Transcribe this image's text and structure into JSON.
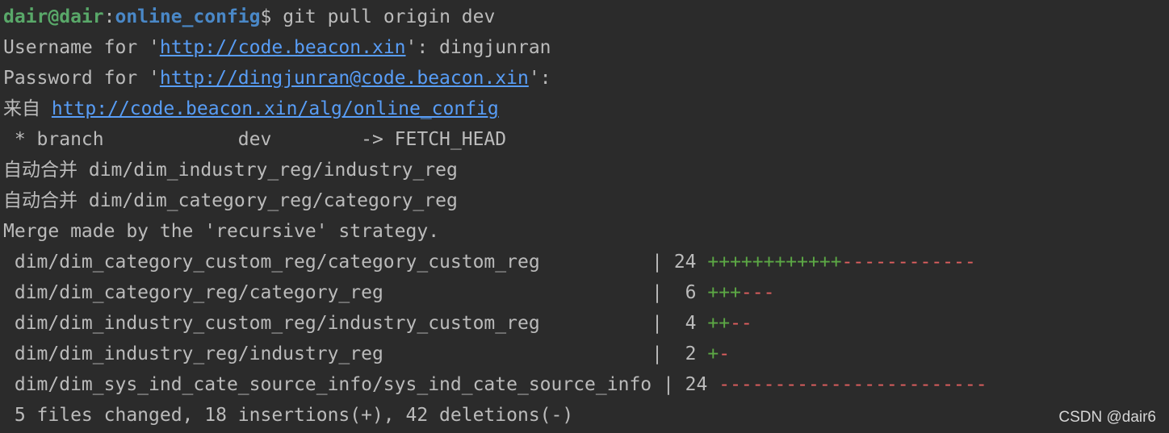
{
  "prompt": {
    "user_host": "dair@dair",
    "separator": ":",
    "cwd": "online_config",
    "symbol": "$ ",
    "command": "git pull origin dev"
  },
  "auth": {
    "username_prefix": "Username for '",
    "username_url": "http://code.beacon.xin",
    "username_suffix": "': dingjunran",
    "password_prefix": "Password for '",
    "password_url": "http://dingjunran@code.beacon.xin",
    "password_suffix": "':"
  },
  "from": {
    "label": "来自 ",
    "url": "http://code.beacon.xin/alg/online_config"
  },
  "branch_line": " * branch            dev        -> FETCH_HEAD",
  "auto_merge": [
    "自动合并 dim/dim_industry_reg/industry_reg",
    "自动合并 dim/dim_category_reg/category_reg"
  ],
  "merge_line": "Merge made by the 'recursive' strategy.",
  "diffstat": [
    {
      "file": " dim/dim_category_custom_reg/category_custom_reg          | 24 ",
      "plus": "++++++++++++",
      "minus": "------------"
    },
    {
      "file": " dim/dim_category_reg/category_reg                        |  6 ",
      "plus": "+++",
      "minus": "---"
    },
    {
      "file": " dim/dim_industry_custom_reg/industry_custom_reg          |  4 ",
      "plus": "++",
      "minus": "--"
    },
    {
      "file": " dim/dim_industry_reg/industry_reg                        |  2 ",
      "plus": "+",
      "minus": "-"
    },
    {
      "file": " dim/dim_sys_ind_cate_source_info/sys_ind_cate_source_info | 24 ",
      "plus": "",
      "minus": "------------------------"
    }
  ],
  "summary": " 5 files changed, 18 insertions(+), 42 deletions(-)",
  "watermark": "CSDN @dair6",
  "colors": {
    "background": "#2b2b2b",
    "text": "#bbbbbb",
    "prompt_user": "#59a869",
    "prompt_path": "#4a88c7",
    "link": "#589df6",
    "insertion": "#5ca845",
    "deletion": "#e05f5f"
  }
}
